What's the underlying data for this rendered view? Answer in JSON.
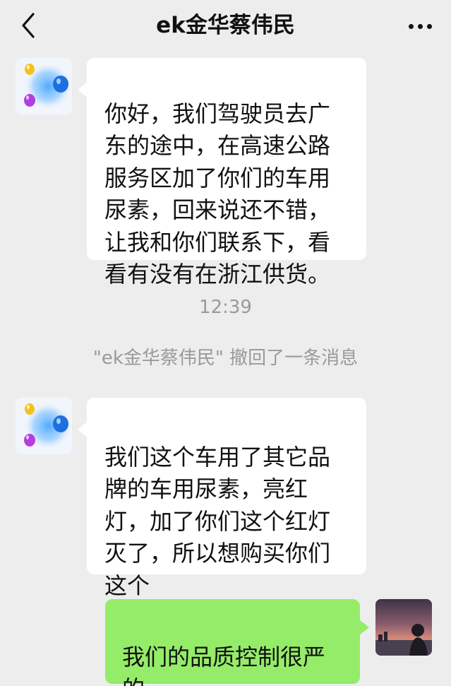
{
  "header": {
    "title": "ek金华蔡伟民",
    "back_icon": "chevron-left-icon",
    "more_icon": "more-horizontal-icon"
  },
  "messages": [
    {
      "sender": "contact",
      "text": "你好，我们驾驶员去广\n东的途中，在高速公路\n服务区加了你们的车用\n尿素，回来说还不错，\n让我和你们联系下，看\n看有没有在浙江供货。"
    },
    {
      "sender": "contact",
      "text": "我们这个车用了其它品\n牌的车用尿素，亮红\n灯，加了你们这个红灯\n灭了，所以想购买你们\n这个"
    },
    {
      "sender": "self",
      "text": "我们的品质控制很严\n的。"
    }
  ],
  "system": {
    "timestamp": "12:39",
    "recall_notice": "\"ek金华蔡伟民\" 撤回了一条消息"
  },
  "colors": {
    "background": "#ededed",
    "incoming_bubble": "#ffffff",
    "outgoing_bubble": "#95ec69",
    "system_text": "#9a9a9a"
  }
}
